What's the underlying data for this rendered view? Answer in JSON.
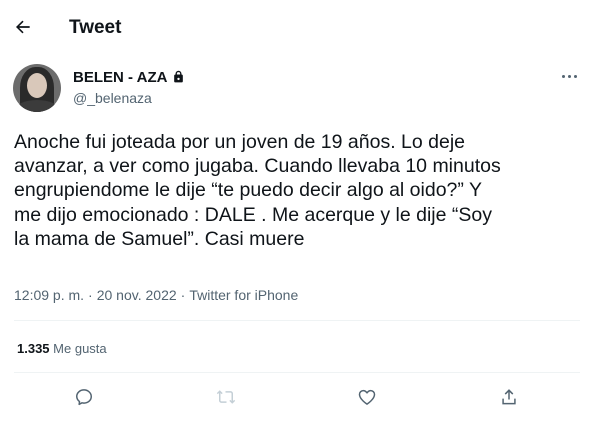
{
  "header": {
    "title": "Tweet",
    "back_icon": "arrow-left-icon"
  },
  "author": {
    "display_name": "BELEN - AZA",
    "handle": "@_belenaza",
    "protected_icon": "lock-icon"
  },
  "tweet": {
    "text": "Anoche fui joteada por un joven de 19 años. Lo deje\navanzar, a ver como jugaba. Cuando llevaba 10 minutos\nengrupiendome le dije “te puedo decir algo al oido?” Y\nme dijo emocionado : DALE . Me acerque y le dije “Soy\nla mama de Samuel”. Casi muere",
    "time": "12:09 p. m.",
    "separator": "·",
    "date": "20 nov. 2022",
    "source": "Twitter for iPhone"
  },
  "stats": {
    "likes_count": "1.335",
    "likes_label": "Me gusta"
  },
  "actions": [
    "reply-icon",
    "retweet-icon",
    "like-icon",
    "share-icon"
  ],
  "colors": {
    "text": "#0f1419",
    "secondary": "#536471",
    "divider": "#eff3f4",
    "retweet_disabled": "#c4cfd6"
  }
}
